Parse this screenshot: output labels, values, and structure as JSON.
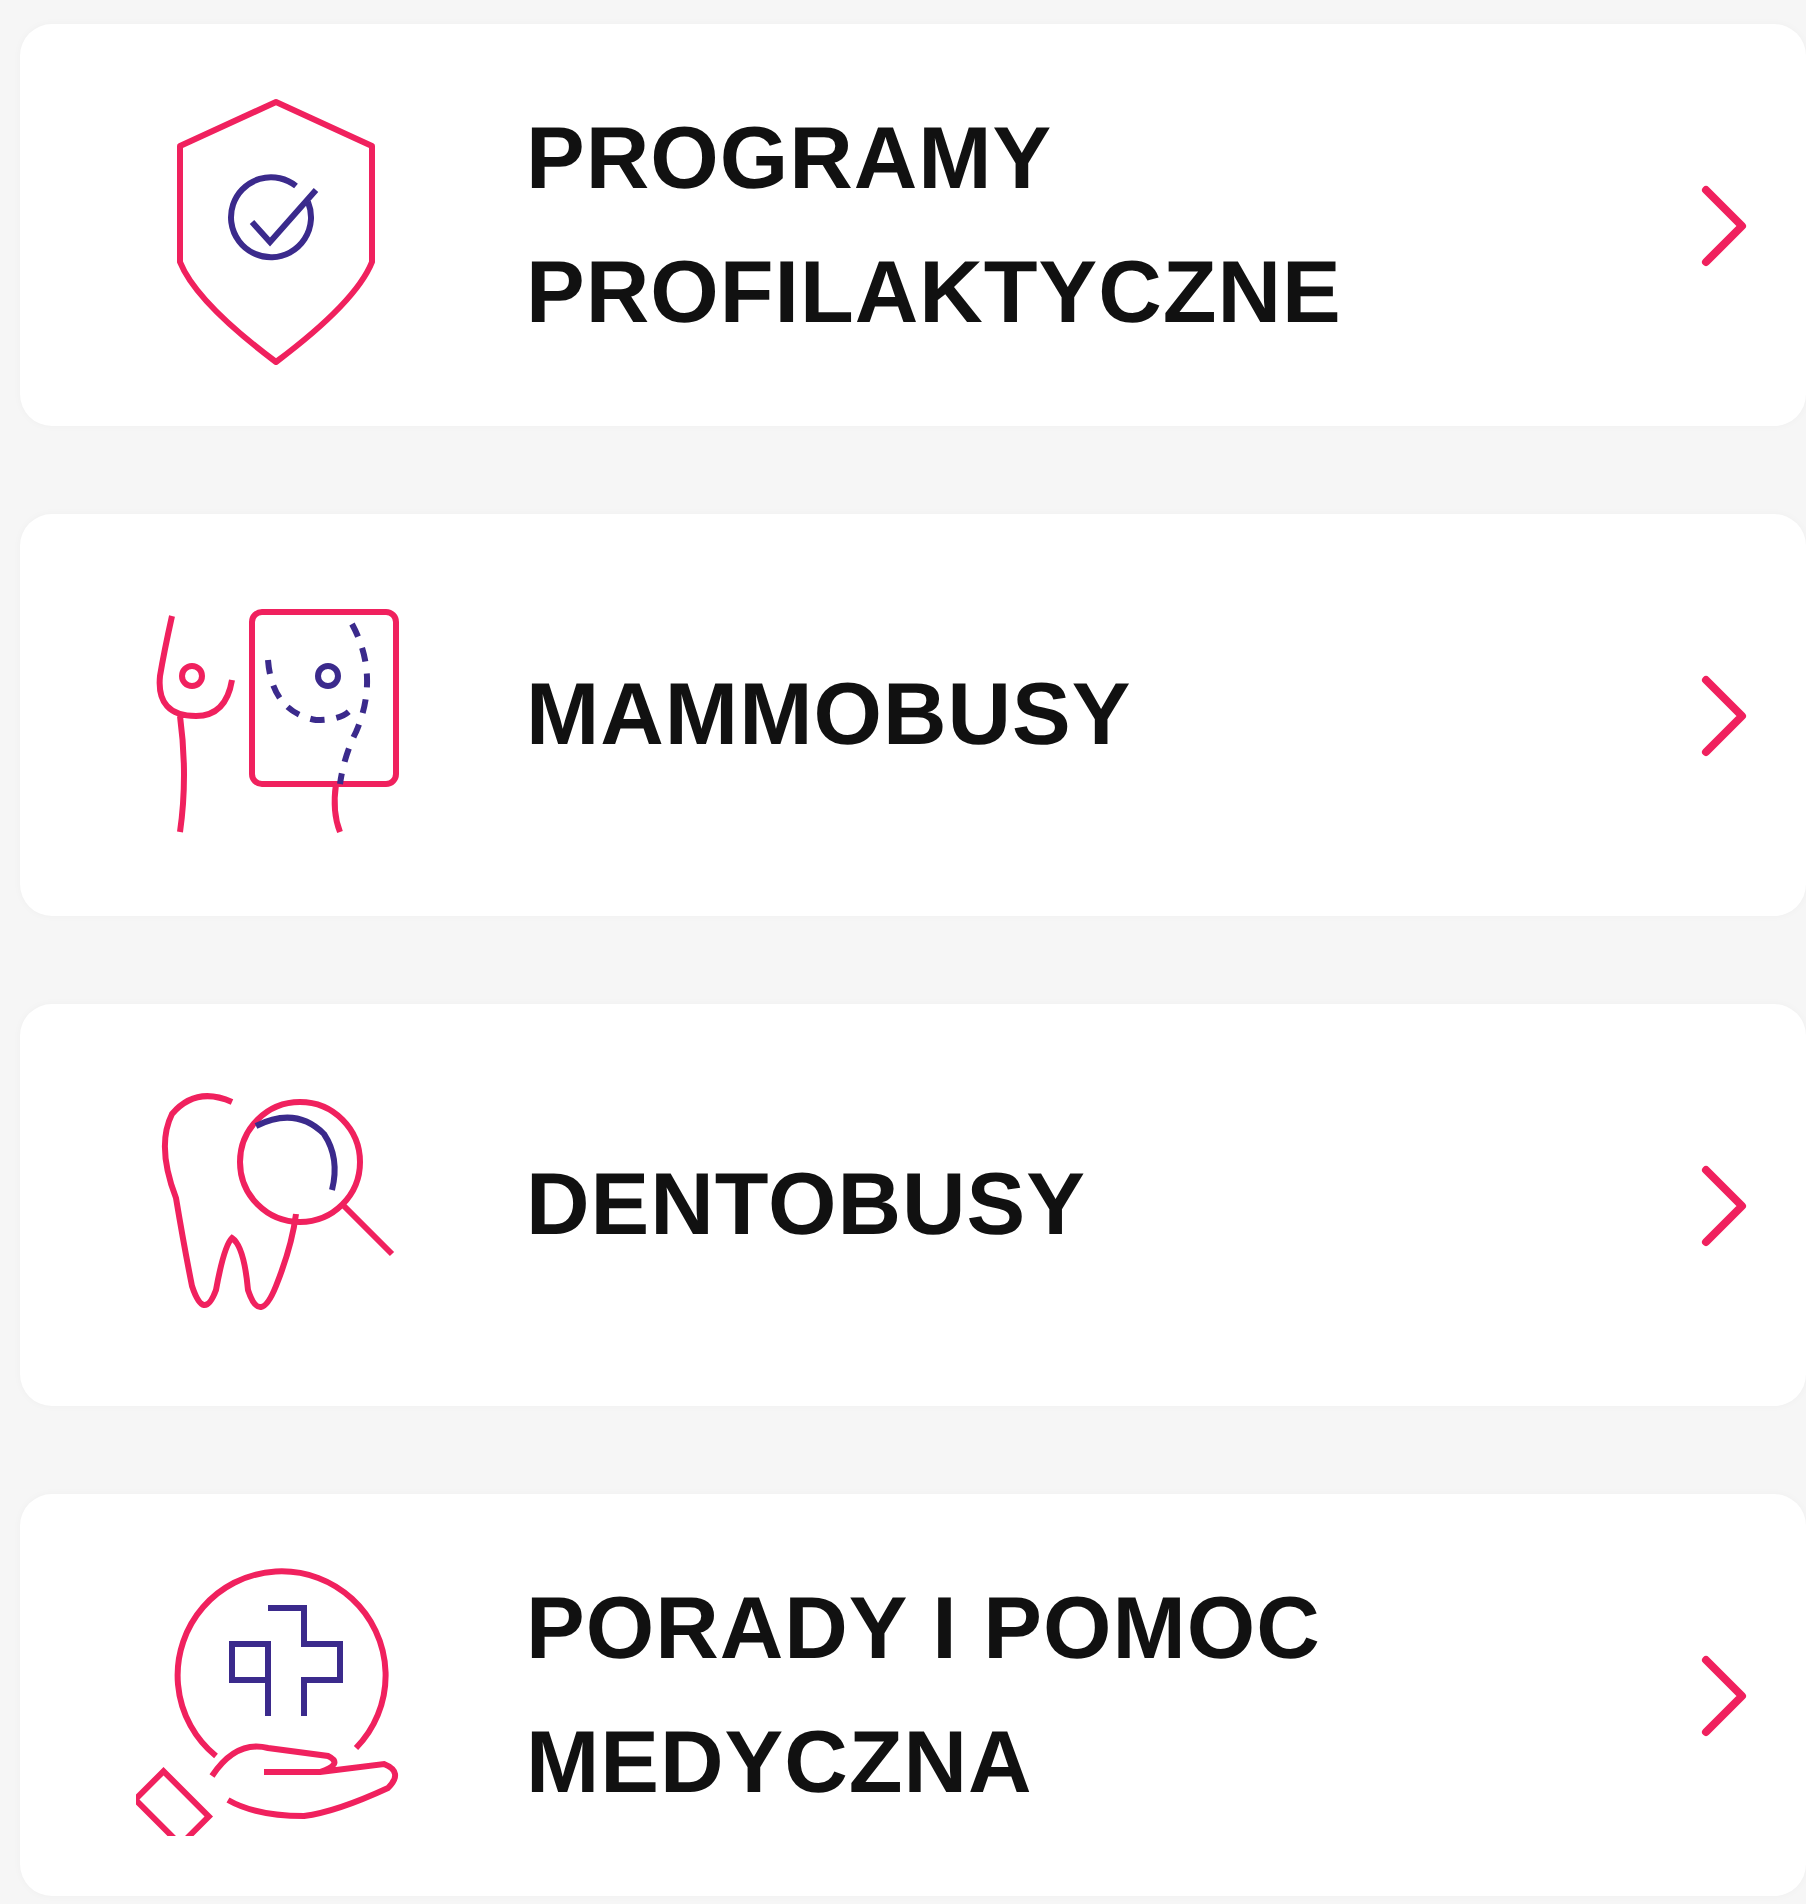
{
  "menu_items": [
    {
      "kind": "shield",
      "label": "PROGRAMY PROFILAKTYCZNE"
    },
    {
      "kind": "mammography",
      "label": "MAMMOBUSY"
    },
    {
      "kind": "tooth",
      "label": "DENTOBUSY"
    },
    {
      "kind": "care",
      "label": "PORADY I POMOC MEDYCZNA"
    }
  ]
}
